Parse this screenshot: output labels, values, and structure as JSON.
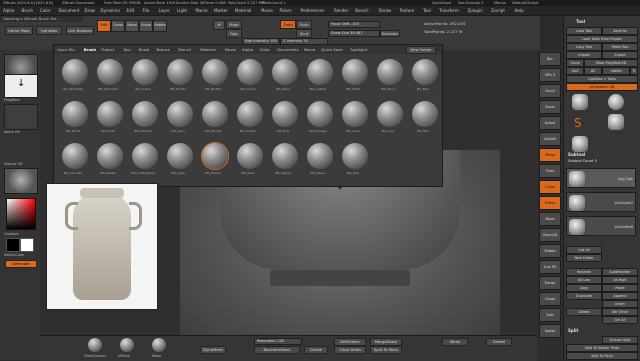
{
  "window": {
    "title_left": "ZBrush 2021.6.6 [2021.6.6]",
    "doc": "ZBrush Document",
    "mem": "Free Mem 55.359GB",
    "active_mem": "Active Mem 1316",
    "scratch": "Scratch Disk 48",
    "timer": "Timer 0.008",
    "polycount": "PolyCount 2.227 MP",
    "meshcount": "MeshCount 1",
    "quicksave": "QuickSave",
    "seethrough": "See-through 0",
    "menus_label": "Menus",
    "script": "DefaultZScript"
  },
  "menubar": [
    "Alpha",
    "Brush",
    "Color",
    "Document",
    "Draw",
    "Dynamics",
    "Edit",
    "File",
    "Layer",
    "Light",
    "Macro",
    "Marker",
    "Material",
    "Movie",
    "Picker",
    "Preferences",
    "Render",
    "Stencil",
    "Stroke",
    "Texture",
    "Tool",
    "Transform",
    "Zplugin",
    "Zscript",
    "Help"
  ],
  "status": "Opening a ZBrush Brush file ...",
  "header": {
    "home": "Home Page",
    "lightbox": "LightBox",
    "livebool": "Live Boolean",
    "edit": "Edit",
    "draw": "Draw",
    "move": "Move",
    "scale": "Scale",
    "rotate": "Rotate",
    "mrgb": "Mrgb",
    "rgb": "Rgb",
    "m": "M",
    "zadd": "Zadd",
    "zsub": "Zsub",
    "zcut": "Zcut",
    "rgb_intensity": "Rgb Intensity 100",
    "z_intensity": "Z Intensity 24",
    "focal_shift": "Focal Shift -100",
    "draw_size": "Draw Size 36.467",
    "dynamic": "Dynamic",
    "active_points": "ActivePoints: 292,034",
    "total_points": "TotalPoints: 2.227 M",
    "new_folder": "New Folder"
  },
  "brush_tabs": [
    "Open File",
    "Brush",
    "Project",
    "Tool",
    "Brush",
    "Texture",
    "Stencil",
    "Material",
    "Movie",
    "Alpha",
    "Grids",
    "Documents",
    "Macro",
    "Quick Save",
    "Spotlight"
  ],
  "brush_tab_active": 1,
  "brushes": [
    "IRS_SkinDetail",
    "IRS_SkinCrack",
    "IRS_Scales",
    "IRS_Rock01",
    "IRS_Rock02",
    "IRS_Cracks",
    "IRS_Wood",
    "IRS_Leather",
    "IRS_Metal",
    "IRS_Stone",
    "IRS_Bark",
    "IRS_Bricks",
    "IRS_Cloth",
    "IRS_Fabric01",
    "IRS_Sand",
    "IRS_Wrinkle",
    "IRS_Scratch",
    "IRS_Dots",
    "IRS_Damage",
    "IRS_Grain",
    "IRS_Lava",
    "IRS_Mud",
    "IRS_Concrete",
    "IRS_Plaster",
    "IRS_LowPolyDmg",
    "IRS_Chips",
    "IRS_Erosion",
    "IRS_Moss",
    "IRS_Ripples",
    "IRS_Weave",
    "IRS_Hide"
  ],
  "brush_selected": 26,
  "left": {
    "alpha_off": "Alpha Off",
    "texture_off": "Texture Off",
    "material": "MatCap Gray",
    "gradient": "Gradient",
    "switch_color": "SwitchColor",
    "alternate": "Alternate",
    "stroke": "DragRect"
  },
  "rbar": [
    "Bpr",
    "SPix 3",
    "Scroll",
    "Zoom",
    "Actual",
    "AAHalf",
    "Persp",
    "Floor",
    "L.Sym",
    "Frame",
    "Move",
    "Zoom3D",
    "Rotate",
    "Line Fill",
    "Transp",
    "Ghost",
    "Solo",
    "Xpose"
  ],
  "rpanel": {
    "tool_title": "Tool",
    "load_tool": "Load Tool",
    "save_as": "Save As",
    "load_tools_project": "Load Tools From Project",
    "copy_tool": "Copy Tool",
    "paste_tool": "Paste Tool",
    "import": "Import",
    "export": "Export",
    "clone": "Clone",
    "make_polymesh": "Make PolyMesh3D",
    "goz": "GoZ",
    "all": "All",
    "visible": "Visible",
    "r": "R",
    "lightbox_tools": "Lightbox > Tools",
    "pcylinder": "pCylinder2. 48",
    "tools": [
      "pCylinder2",
      "Sphere3D",
      "PolyMesh3D",
      "SimpleBrush",
      "pCylinder2"
    ],
    "subtool_title": "Subtool",
    "subtool_count": "Subtool Count 5",
    "subtools": [
      "Jug_High",
      "pCylinder2",
      "pCylinder6"
    ],
    "list_all": "List All",
    "new_folder": "New Folder",
    "rename": "Rename",
    "autoreorder": "AutoReorder",
    "all_low": "All Low",
    "all_high": "All High",
    "copy": "Copy",
    "paste": "Paste",
    "duplicate": "Duplicate",
    "append": "Append",
    "insert": "Insert",
    "delete": "Delete",
    "del_other": "Del Other",
    "del_all": "Del All",
    "split": "Split",
    "groups_split": "Groups Split",
    "split_similar": "Split To Similar Parts",
    "split_parts": "Split To Parts"
  },
  "bottom": {
    "brushes": [
      "TrimDynamic",
      "hPolish",
      "Move"
    ],
    "resolution": "Resolution 128",
    "dynamesh": "DynaMesh",
    "backface": "BackfaceMask",
    "divide": "Divide",
    "delhidden": "DelHidden",
    "closeholes": "Close Holes",
    "mergedown": "MergeDown",
    "split_parts": "Split To Parts",
    "ikeep": "IKeep",
    "delete": "Delete"
  },
  "colors": {
    "accent": "#d9691d",
    "panel": "#3b3b3b",
    "bg": "#2b2b2b"
  }
}
